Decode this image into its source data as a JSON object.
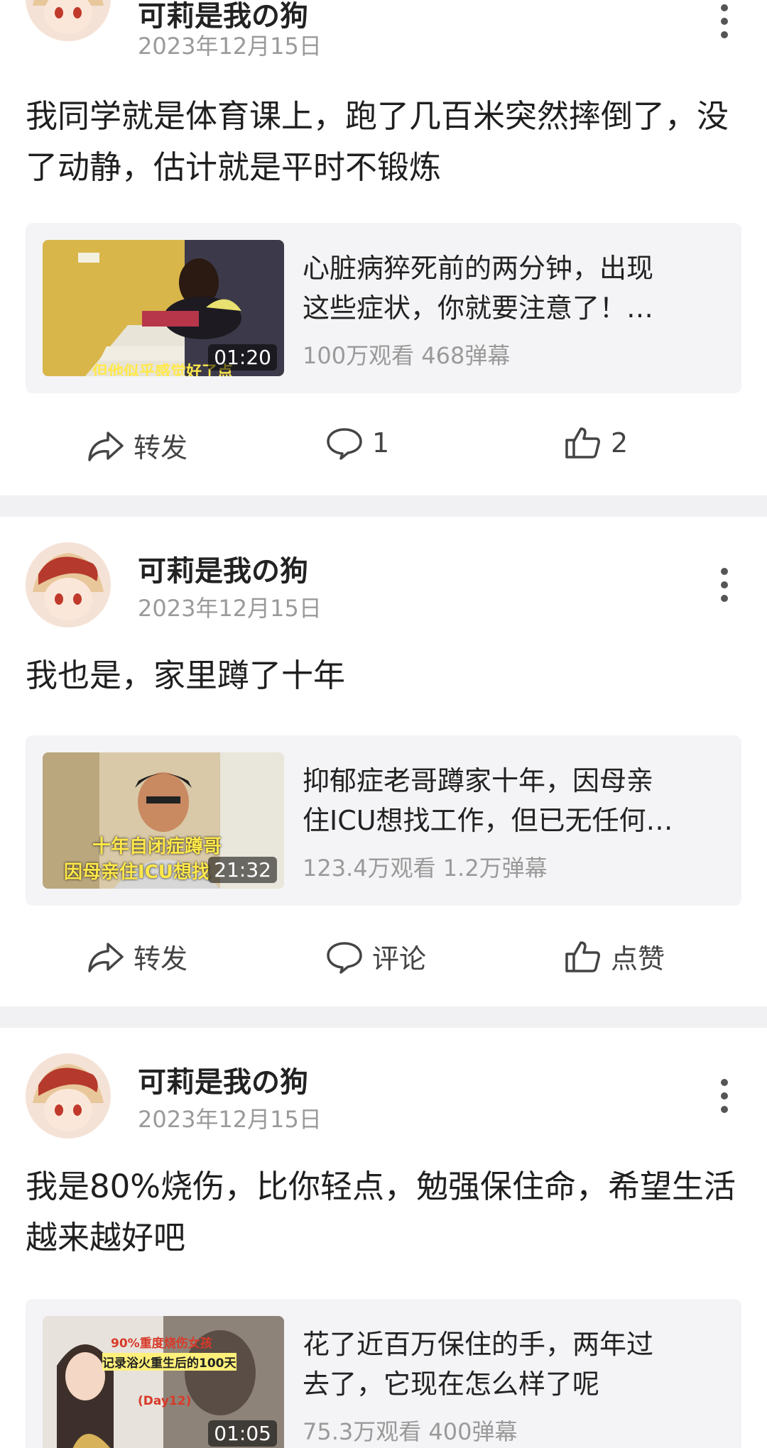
{
  "posts": [
    {
      "username": "可莉是我の狗",
      "date": "2023年12月15日",
      "content": "我同学就是体育课上，跑了几百米突然摔倒了，没了动静，估计就是平时不锻炼",
      "video": {
        "title_line1": "心脏病猝死前的两分钟，出现",
        "title_line2": "这些症状，你就要注意了！…",
        "duration": "01:20",
        "stats": "100万观看 468弹幕",
        "caption": "但他似乎感觉好了点"
      },
      "actions": {
        "share": "转发",
        "comment": "1",
        "like": "2"
      }
    },
    {
      "username": "可莉是我の狗",
      "date": "2023年12月15日",
      "content": "我也是，家里蹲了十年",
      "video": {
        "title_line1": "抑郁症老哥蹲家十年，因母亲",
        "title_line2": "住ICU想找工作，但已无任何…",
        "duration": "21:32",
        "stats": "123.4万观看 1.2万弹幕",
        "caption_line1": "十年自闭症蹲哥",
        "caption_line2": "因母亲住ICU想找"
      },
      "actions": {
        "share": "转发",
        "comment": "评论",
        "like": "点赞"
      }
    },
    {
      "username": "可莉是我の狗",
      "date": "2023年12月15日",
      "content": "我是80%烧伤，比你轻点，勉强保住命，希望生活越来越好吧",
      "video": {
        "title_line1": "花了近百万保住的手，两年过",
        "title_line2": "去了，它现在怎么样了呢",
        "duration": "01:05",
        "stats": "75.3万观看 400弹幕",
        "caption_line1": "90%重度烧伤女孩",
        "caption_line2": "记录浴火重生后的100天",
        "caption_line3": "(Day12)"
      }
    }
  ],
  "colors": {
    "divider": "#f1f1f3",
    "card": "#f4f4f6",
    "meta": "#9a9a9a"
  }
}
